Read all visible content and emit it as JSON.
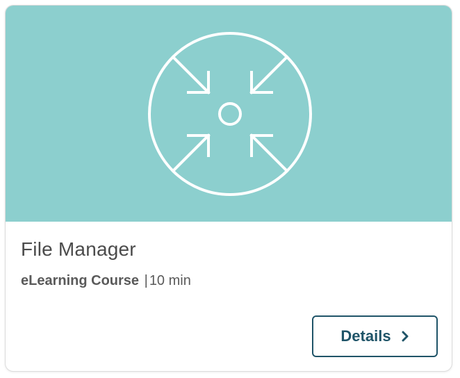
{
  "card": {
    "title": "File Manager",
    "course_type": "eLearning Course",
    "separator": "|",
    "duration": "10 min",
    "details_label": "Details",
    "hero_icon": "focus-arrows-in-circle-icon",
    "details_icon": "chevron-right-icon"
  },
  "colors": {
    "hero_background": "#8ccfce",
    "icon_stroke": "#ffffff",
    "button_accent": "#1f5468",
    "title_text": "#4b4b4b"
  }
}
